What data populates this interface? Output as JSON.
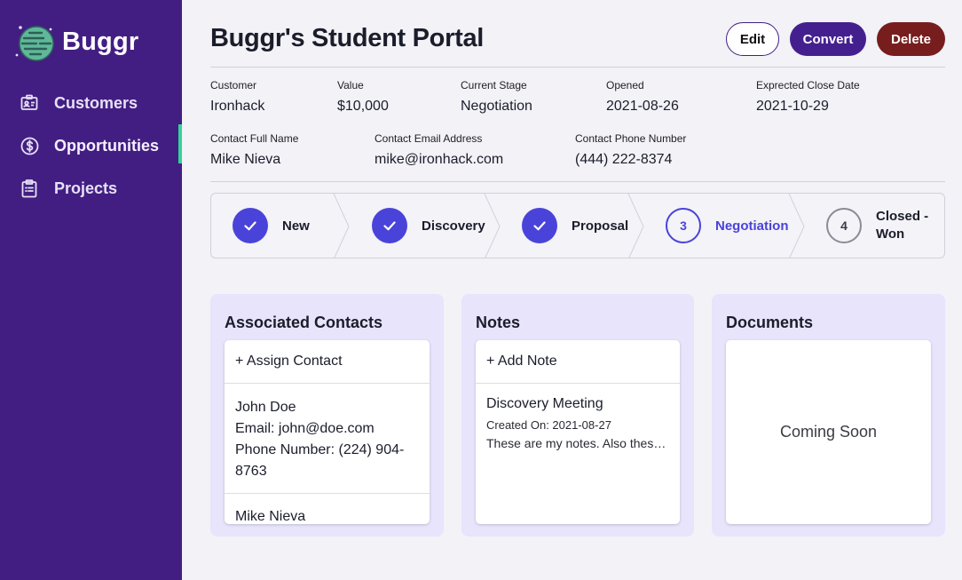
{
  "app": {
    "name": "Buggr"
  },
  "sidebar": {
    "items": [
      {
        "label": "Customers",
        "icon": "contact-card-icon"
      },
      {
        "label": "Opportunities",
        "icon": "dollar-circle-icon",
        "active": true
      },
      {
        "label": "Projects",
        "icon": "clipboard-icon"
      }
    ]
  },
  "header": {
    "title": "Buggr's Student Portal",
    "edit_label": "Edit",
    "convert_label": "Convert",
    "delete_label": "Delete"
  },
  "details": {
    "customer": {
      "label": "Customer",
      "value": "Ironhack"
    },
    "value": {
      "label": "Value",
      "value": "$10,000"
    },
    "stage": {
      "label": "Current Stage",
      "value": "Negotiation"
    },
    "opened": {
      "label": "Opened",
      "value": "2021-08-26"
    },
    "close_date": {
      "label": "Exprected Close Date",
      "value": "2021-10-29"
    },
    "contact_name": {
      "label": "Contact Full Name",
      "value": "Mike Nieva"
    },
    "contact_email": {
      "label": "Contact Email Address",
      "value": "mike@ironhack.com"
    },
    "contact_phone": {
      "label": "Contact Phone Number",
      "value": "(444) 222-8374"
    }
  },
  "stages": [
    {
      "label": "New",
      "status": "complete"
    },
    {
      "label": "Discovery",
      "status": "complete"
    },
    {
      "label": "Proposal",
      "status": "complete"
    },
    {
      "label": "Negotiation",
      "number": "3",
      "status": "current"
    },
    {
      "label": "Closed - Won",
      "number": "4",
      "status": "upcoming"
    }
  ],
  "contacts_card": {
    "title": "Associated Contacts",
    "add_label": "+ Assign Contact",
    "contacts": [
      {
        "name": "John Doe",
        "email": "Email: john@doe.com",
        "phone": "Phone Number: (224) 904-8763"
      },
      {
        "name": "Mike Nieva"
      }
    ]
  },
  "notes_card": {
    "title": "Notes",
    "add_label": "+ Add Note",
    "notes": [
      {
        "title": "Discovery Meeting",
        "created": "Created On: 2021-08-27",
        "body": "These are my notes. Also these are my notes."
      }
    ]
  },
  "documents_card": {
    "title": "Documents",
    "placeholder": "Coming Soon"
  },
  "colors": {
    "sidebar": "#431e82",
    "accent": "#4a43d9",
    "active_indicator": "#34d399",
    "delete": "#771d1d",
    "card_bg": "#e8e4fb"
  }
}
